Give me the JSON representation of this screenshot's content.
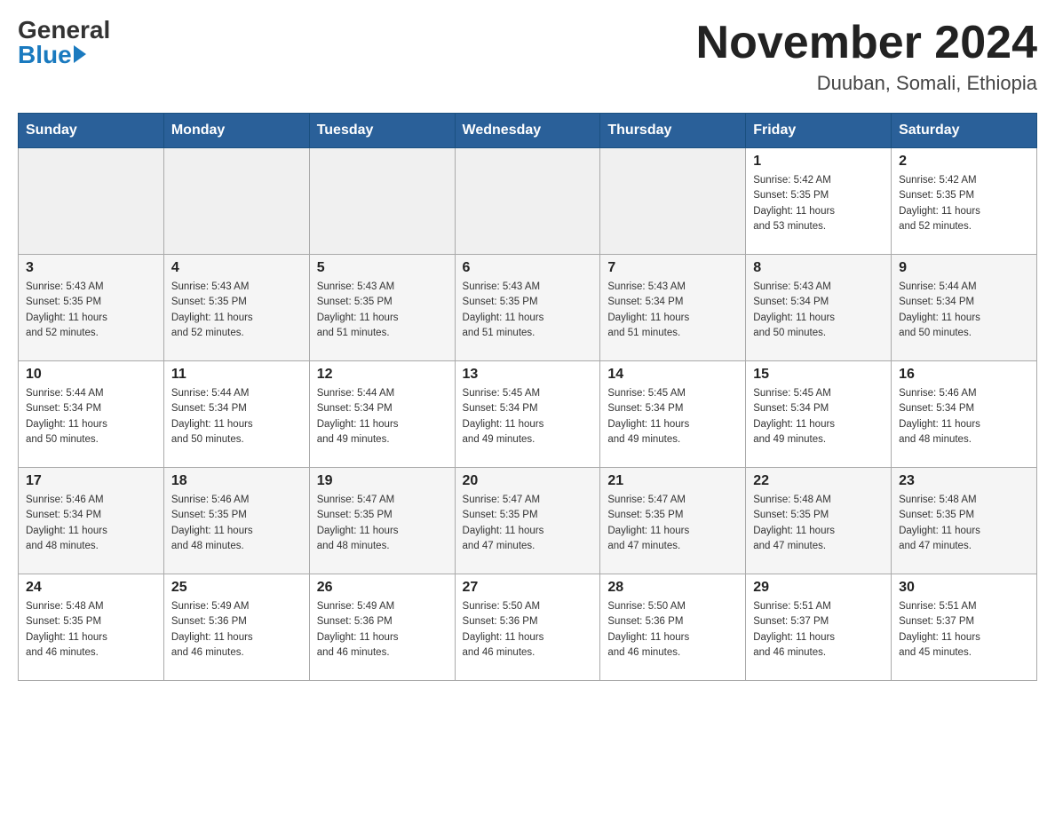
{
  "logo": {
    "general": "General",
    "blue": "Blue"
  },
  "title": {
    "month_year": "November 2024",
    "location": "Duuban, Somali, Ethiopia"
  },
  "days_of_week": [
    "Sunday",
    "Monday",
    "Tuesday",
    "Wednesday",
    "Thursday",
    "Friday",
    "Saturday"
  ],
  "weeks": [
    [
      {
        "day": "",
        "info": ""
      },
      {
        "day": "",
        "info": ""
      },
      {
        "day": "",
        "info": ""
      },
      {
        "day": "",
        "info": ""
      },
      {
        "day": "",
        "info": ""
      },
      {
        "day": "1",
        "info": "Sunrise: 5:42 AM\nSunset: 5:35 PM\nDaylight: 11 hours\nand 53 minutes."
      },
      {
        "day": "2",
        "info": "Sunrise: 5:42 AM\nSunset: 5:35 PM\nDaylight: 11 hours\nand 52 minutes."
      }
    ],
    [
      {
        "day": "3",
        "info": "Sunrise: 5:43 AM\nSunset: 5:35 PM\nDaylight: 11 hours\nand 52 minutes."
      },
      {
        "day": "4",
        "info": "Sunrise: 5:43 AM\nSunset: 5:35 PM\nDaylight: 11 hours\nand 52 minutes."
      },
      {
        "day": "5",
        "info": "Sunrise: 5:43 AM\nSunset: 5:35 PM\nDaylight: 11 hours\nand 51 minutes."
      },
      {
        "day": "6",
        "info": "Sunrise: 5:43 AM\nSunset: 5:35 PM\nDaylight: 11 hours\nand 51 minutes."
      },
      {
        "day": "7",
        "info": "Sunrise: 5:43 AM\nSunset: 5:34 PM\nDaylight: 11 hours\nand 51 minutes."
      },
      {
        "day": "8",
        "info": "Sunrise: 5:43 AM\nSunset: 5:34 PM\nDaylight: 11 hours\nand 50 minutes."
      },
      {
        "day": "9",
        "info": "Sunrise: 5:44 AM\nSunset: 5:34 PM\nDaylight: 11 hours\nand 50 minutes."
      }
    ],
    [
      {
        "day": "10",
        "info": "Sunrise: 5:44 AM\nSunset: 5:34 PM\nDaylight: 11 hours\nand 50 minutes."
      },
      {
        "day": "11",
        "info": "Sunrise: 5:44 AM\nSunset: 5:34 PM\nDaylight: 11 hours\nand 50 minutes."
      },
      {
        "day": "12",
        "info": "Sunrise: 5:44 AM\nSunset: 5:34 PM\nDaylight: 11 hours\nand 49 minutes."
      },
      {
        "day": "13",
        "info": "Sunrise: 5:45 AM\nSunset: 5:34 PM\nDaylight: 11 hours\nand 49 minutes."
      },
      {
        "day": "14",
        "info": "Sunrise: 5:45 AM\nSunset: 5:34 PM\nDaylight: 11 hours\nand 49 minutes."
      },
      {
        "day": "15",
        "info": "Sunrise: 5:45 AM\nSunset: 5:34 PM\nDaylight: 11 hours\nand 49 minutes."
      },
      {
        "day": "16",
        "info": "Sunrise: 5:46 AM\nSunset: 5:34 PM\nDaylight: 11 hours\nand 48 minutes."
      }
    ],
    [
      {
        "day": "17",
        "info": "Sunrise: 5:46 AM\nSunset: 5:34 PM\nDaylight: 11 hours\nand 48 minutes."
      },
      {
        "day": "18",
        "info": "Sunrise: 5:46 AM\nSunset: 5:35 PM\nDaylight: 11 hours\nand 48 minutes."
      },
      {
        "day": "19",
        "info": "Sunrise: 5:47 AM\nSunset: 5:35 PM\nDaylight: 11 hours\nand 48 minutes."
      },
      {
        "day": "20",
        "info": "Sunrise: 5:47 AM\nSunset: 5:35 PM\nDaylight: 11 hours\nand 47 minutes."
      },
      {
        "day": "21",
        "info": "Sunrise: 5:47 AM\nSunset: 5:35 PM\nDaylight: 11 hours\nand 47 minutes."
      },
      {
        "day": "22",
        "info": "Sunrise: 5:48 AM\nSunset: 5:35 PM\nDaylight: 11 hours\nand 47 minutes."
      },
      {
        "day": "23",
        "info": "Sunrise: 5:48 AM\nSunset: 5:35 PM\nDaylight: 11 hours\nand 47 minutes."
      }
    ],
    [
      {
        "day": "24",
        "info": "Sunrise: 5:48 AM\nSunset: 5:35 PM\nDaylight: 11 hours\nand 46 minutes."
      },
      {
        "day": "25",
        "info": "Sunrise: 5:49 AM\nSunset: 5:36 PM\nDaylight: 11 hours\nand 46 minutes."
      },
      {
        "day": "26",
        "info": "Sunrise: 5:49 AM\nSunset: 5:36 PM\nDaylight: 11 hours\nand 46 minutes."
      },
      {
        "day": "27",
        "info": "Sunrise: 5:50 AM\nSunset: 5:36 PM\nDaylight: 11 hours\nand 46 minutes."
      },
      {
        "day": "28",
        "info": "Sunrise: 5:50 AM\nSunset: 5:36 PM\nDaylight: 11 hours\nand 46 minutes."
      },
      {
        "day": "29",
        "info": "Sunrise: 5:51 AM\nSunset: 5:37 PM\nDaylight: 11 hours\nand 46 minutes."
      },
      {
        "day": "30",
        "info": "Sunrise: 5:51 AM\nSunset: 5:37 PM\nDaylight: 11 hours\nand 45 minutes."
      }
    ]
  ]
}
